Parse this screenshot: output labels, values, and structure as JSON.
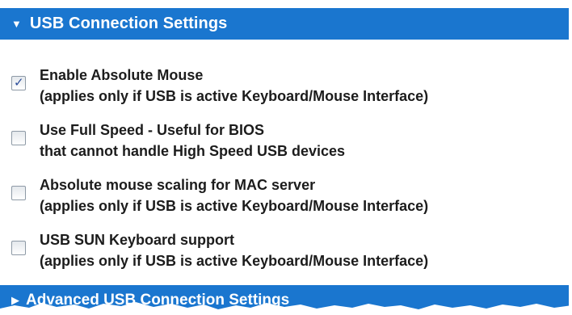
{
  "header": {
    "title": "USB Connection Settings",
    "toggle_icon": "triangle-down-icon",
    "color": "#1a76cf"
  },
  "options": [
    {
      "checked": true,
      "line1": "Enable Absolute Mouse",
      "line2": "(applies only if USB is active Keyboard/Mouse Interface)"
    },
    {
      "checked": false,
      "line1": "Use Full Speed - Useful for BIOS",
      "line2": "that cannot handle High Speed USB devices"
    },
    {
      "checked": false,
      "line1": "Absolute mouse scaling for MAC server",
      "line2": "(applies only if USB is active Keyboard/Mouse Interface)"
    },
    {
      "checked": false,
      "line1": "USB SUN Keyboard support",
      "line2": "(applies only if USB is active Keyboard/Mouse Interface)"
    }
  ],
  "advanced": {
    "title": "Advanced USB Connection Settings",
    "toggle_icon": "triangle-right-icon"
  }
}
